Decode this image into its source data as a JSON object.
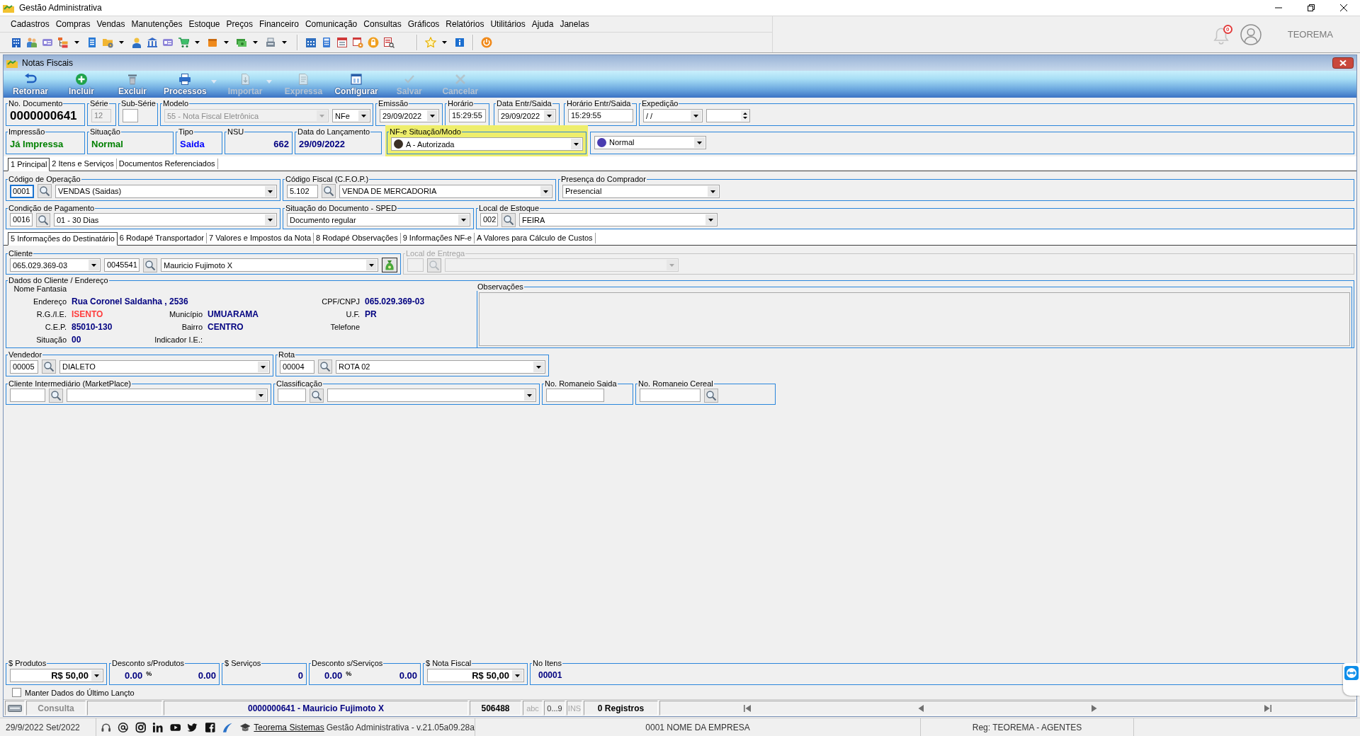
{
  "window": {
    "title": "Gestão Administrativa"
  },
  "menu": [
    "Cadastros",
    "Compras",
    "Vendas",
    "Manutenções",
    "Estoque",
    "Preços",
    "Financeiro",
    "Comunicação",
    "Consultas",
    "Gráficos",
    "Relatórios",
    "Utilitários",
    "Ajuda",
    "Janelas"
  ],
  "toolbar": [
    [
      {
        "dropdown": false
      },
      {
        "dropdown": false
      },
      {
        "dropdown": false
      },
      {
        "dropdown": true
      },
      {
        "dropdown": false
      },
      {
        "dropdown": true
      },
      {
        "dropdown": false
      },
      {
        "dropdown": false
      },
      {
        "dropdown": false
      },
      {
        "dropdown": true
      },
      {
        "dropdown": true
      },
      {
        "dropdown": true
      },
      {
        "dropdown": true
      }
    ],
    [
      {
        "dropdown": false
      },
      {
        "dropdown": false
      },
      {
        "dropdown": false
      },
      {
        "dropdown": false
      },
      {
        "dropdown": false
      },
      {
        "dropdown": false
      }
    ],
    [
      {
        "dropdown": true
      },
      {
        "dropdown": false
      }
    ],
    [
      {
        "dropdown": false
      }
    ]
  ],
  "notifications": {
    "count": "0"
  },
  "user": {
    "name": "TEOREMA"
  },
  "form": {
    "title": "Notas Fiscais",
    "actions": [
      {
        "label": "Retornar",
        "disabled": false,
        "dropdown": false
      },
      {
        "label": "Incluir",
        "disabled": false,
        "dropdown": false
      },
      {
        "label": "Excluir",
        "disabled": false,
        "dropdown": false
      },
      {
        "label": "Processos",
        "disabled": false,
        "dropdown": true
      },
      {
        "label": "Importar",
        "disabled": true,
        "dropdown": true
      },
      {
        "label": "Expressa",
        "disabled": true,
        "dropdown": false
      },
      {
        "label": "Configurar",
        "disabled": false,
        "dropdown": false
      },
      {
        "label": "Salvar",
        "disabled": true,
        "dropdown": false
      },
      {
        "label": "Cancelar",
        "disabled": true,
        "dropdown": false
      }
    ],
    "header_rows": [
      [
        {
          "label": "No. Documento",
          "controls": [
            {
              "kind": "big",
              "value": "0000000641"
            }
          ]
        },
        {
          "label": "Série",
          "controls": [
            {
              "kind": "field",
              "value": "12",
              "disabled": true
            }
          ]
        },
        {
          "label": "Sub-Série",
          "controls": [
            {
              "kind": "field"
            }
          ]
        },
        {
          "label": "Modelo",
          "controls": [
            {
              "kind": "combo",
              "value": "55 - Nota Fiscal Eletrônica",
              "disabled": true
            },
            {
              "kind": "combo",
              "value": "NFe"
            }
          ]
        },
        {
          "label": "Emissão",
          "controls": [
            {
              "kind": "combo",
              "value": "29/09/2022"
            }
          ]
        },
        {
          "label": "Horário",
          "controls": [
            {
              "kind": "field",
              "value": "15:29:55"
            }
          ]
        },
        {
          "label": "Data Entr/Saida",
          "controls": [
            {
              "kind": "combo",
              "value": "29/09/2022"
            }
          ]
        },
        {
          "label": "Horário Entr/Saida",
          "controls": [
            {
              "kind": "field",
              "value": "15:29:55"
            }
          ]
        },
        {
          "label": "Expedição",
          "controls": [
            {
              "kind": "combo",
              "value": "/ /"
            },
            {
              "kind": "spin"
            }
          ]
        }
      ],
      [
        {
          "label": "Impressão",
          "controls": [
            {
              "kind": "display",
              "value": "Já Impressa",
              "color": "#008000"
            }
          ]
        },
        {
          "label": "Situação",
          "controls": [
            {
              "kind": "display",
              "value": "Normal",
              "color": "#008000"
            }
          ]
        },
        {
          "label": "Tipo",
          "controls": [
            {
              "kind": "display",
              "value": "Saida",
              "color": "#0000ff"
            }
          ]
        },
        {
          "label": "NSU",
          "controls": [
            {
              "kind": "display",
              "value": "662",
              "color": "#000080"
            }
          ]
        },
        {
          "label": "Data do Lançamento",
          "controls": [
            {
              "kind": "display",
              "value": "29/09/2022",
              "color": "#000080"
            }
          ]
        },
        {
          "label": "NF-e Situação/Modo",
          "highlighted": true,
          "controls": [
            {
              "kind": "combo",
              "value": "A - Autorizada",
              "color": "#3b3026"
            }
          ]
        },
        {
          "controls": [
            {
              "kind": "combo",
              "value": "Normal",
              "color": "#4a3cb0"
            }
          ]
        }
      ]
    ],
    "tabs": [
      {
        "label": "1 Principal",
        "selected": true
      },
      {
        "label": "2 Itens e Serviços",
        "selected": false
      },
      {
        "label": "Documentos Referenciados",
        "selected": false
      }
    ],
    "main_rows": [
      [
        {
          "label": "Código de Operação",
          "controls": [
            {
              "kind": "field",
              "value": "0001",
              "focused": true
            },
            {
              "kind": "lookup"
            },
            {
              "kind": "combo",
              "value": "VENDAS (Saidas)"
            }
          ]
        },
        {
          "label": "Código Fiscal (C.F.O.P.)",
          "controls": [
            {
              "kind": "field",
              "value": "5.102"
            },
            {
              "kind": "lookup"
            },
            {
              "kind": "combo",
              "value": "VENDA DE MERCADORIA"
            }
          ]
        },
        {
          "label": "Presença do Comprador",
          "controls": [
            {
              "kind": "combo",
              "value": "Presencial"
            }
          ]
        }
      ],
      [
        {
          "label": "Condição de Pagamento",
          "controls": [
            {
              "kind": "field",
              "value": "0016"
            },
            {
              "kind": "lookup"
            },
            {
              "kind": "combo",
              "value": "01 - 30 Dias"
            }
          ]
        },
        {
          "label": "Situação do Documento - SPED",
          "controls": [
            {
              "kind": "combo",
              "value": "Documento regular"
            }
          ]
        },
        {
          "label": "Local de Estoque",
          "controls": [
            {
              "kind": "field",
              "value": "002"
            },
            {
              "kind": "lookup"
            },
            {
              "kind": "combo",
              "value": "FEIRA"
            }
          ]
        }
      ]
    ],
    "subtabs": [
      {
        "label": "5 Informações do Destinatário",
        "selected": true
      },
      {
        "label": "6 Rodapé Transportador",
        "selected": false
      },
      {
        "label": "7 Valores e Impostos da Nota",
        "selected": false
      },
      {
        "label": "8 Rodapé Observações",
        "selected": false
      },
      {
        "label": "9 Informações NF-e",
        "selected": false
      },
      {
        "label": "A Valores para Cálculo de Custos",
        "selected": false
      }
    ],
    "client_rows": [
      [
        {
          "label": "Cliente",
          "controls": [
            {
              "kind": "combo",
              "value": "065.029.369-03"
            },
            {
              "kind": "field",
              "value": "0045541"
            },
            {
              "kind": "lookup"
            },
            {
              "kind": "combo",
              "value": "Mauricio Fujimoto X"
            },
            {
              "kind": "button"
            }
          ]
        },
        {
          "label": "Local de Entrega",
          "disabled": true,
          "controls": [
            {
              "kind": "field"
            },
            {
              "kind": "lookup"
            },
            {
              "kind": "combo"
            }
          ]
        }
      ]
    ],
    "client_info": {
      "title": "Dados do Cliente / Endereço",
      "fields": [
        {
          "label": "Nome Fantasia"
        },
        {
          "label": "Endereço",
          "value": "Rua Coronel Saldanha , 2536",
          "color": "#000080"
        },
        {
          "label": "CPF/CNPJ",
          "value": "065.029.369-03",
          "color": "#000080"
        },
        {
          "label": "R.G./I.E.",
          "value": "ISENTO",
          "color": "#ff3c3c"
        },
        {
          "label": "Município",
          "value": "UMUARAMA",
          "color": "#000080"
        },
        {
          "label": "U.F.",
          "value": "PR",
          "color": "#000080"
        },
        {
          "label": "C.E.P.",
          "value": "85010-130",
          "color": "#000080"
        },
        {
          "label": "Bairro",
          "value": "CENTRO",
          "color": "#000080"
        },
        {
          "label": "Telefone"
        },
        {
          "label": "Situação",
          "value": "00",
          "color": "#000080"
        },
        {
          "label": "Indicador I.E.:"
        }
      ],
      "notes": {
        "label": "Observações"
      }
    },
    "lower_rows": [
      [
        {
          "label": "Vendedor",
          "controls": [
            {
              "kind": "field",
              "value": "00005"
            },
            {
              "kind": "lookup"
            },
            {
              "kind": "combo",
              "value": "DIALETO"
            }
          ]
        },
        {
          "label": "Rota",
          "controls": [
            {
              "kind": "field",
              "value": "00004"
            },
            {
              "kind": "lookup"
            },
            {
              "kind": "combo",
              "value": "ROTA 02"
            }
          ]
        }
      ],
      [
        {
          "label": "Cliente Intermediário (MarketPlace)",
          "controls": [
            {
              "kind": "field"
            },
            {
              "kind": "lookup"
            },
            {
              "kind": "combo"
            }
          ]
        },
        {
          "label": "Classificação",
          "controls": [
            {
              "kind": "field"
            },
            {
              "kind": "lookup"
            },
            {
              "kind": "combo"
            }
          ]
        },
        {
          "label": "No. Romaneio Saida",
          "controls": [
            {
              "kind": "field"
            }
          ]
        },
        {
          "label": "No. Romaneio Cereal",
          "controls": [
            {
              "kind": "field"
            },
            {
              "kind": "lookup"
            }
          ]
        }
      ]
    ],
    "totals": [
      {
        "label": "$ Produtos",
        "controls": [
          {
            "kind": "amount",
            "value": "R$ 50,00"
          }
        ]
      },
      {
        "label": "Desconto s/Produtos",
        "controls": [
          {
            "kind": "display",
            "value": "0.00",
            "color": "#000080"
          },
          {
            "kind": "unit",
            "value": "%"
          },
          {
            "kind": "display",
            "value": "0.00",
            "color": "#000080"
          }
        ]
      },
      {
        "label": "$ Serviços",
        "controls": [
          {
            "kind": "display",
            "value": "0",
            "color": "#000080"
          }
        ]
      },
      {
        "label": "Desconto s/Serviços",
        "controls": [
          {
            "kind": "display",
            "value": "0.00",
            "color": "#000080"
          },
          {
            "kind": "unit",
            "value": "%"
          },
          {
            "kind": "display",
            "value": "0.00",
            "color": "#000080"
          }
        ]
      },
      {
        "label": "$ Nota Fiscal",
        "controls": [
          {
            "kind": "amount",
            "value": "R$ 50,00"
          }
        ]
      },
      {
        "label": "No Itens",
        "controls": [
          {
            "kind": "display",
            "value": "00001",
            "color": "#000080"
          }
        ]
      }
    ],
    "keep_data": {
      "label": "Manter Dados do Último Lançto",
      "checked": false
    },
    "status_bar": {
      "mode": "Consulta",
      "record": "0000000641 - Mauricio Fujimoto X",
      "code": "506488",
      "indicators": [
        {
          "label": "abc",
          "on": false
        },
        {
          "label": "0...9",
          "on": true
        },
        {
          "label": "INS",
          "on": false
        }
      ],
      "count": "0 Registros"
    }
  },
  "app_status": {
    "date": "29/9/2022 Set/2022",
    "link": "Teorema Sistemas",
    "version": "Gestão Administrativa - v.21.05a09.28a",
    "company": "0001 NOME DA EMPRESA",
    "registration": "Reg: TEOREMA - AGENTES"
  }
}
